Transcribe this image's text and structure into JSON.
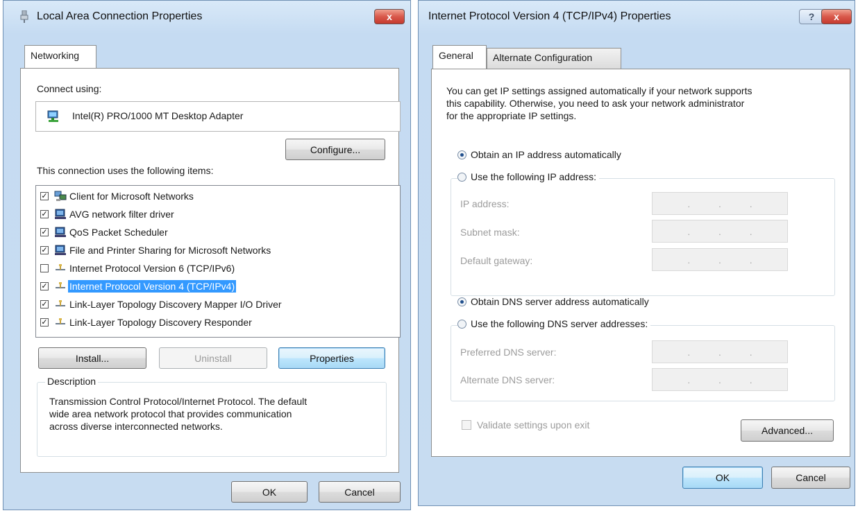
{
  "left_dialog": {
    "title": "Local Area Connection Properties",
    "close_label": "x",
    "tab": "Networking",
    "connect_using_label": "Connect using:",
    "adapter_name": "Intel(R) PRO/1000 MT Desktop Adapter",
    "configure_label": "Configure...",
    "items_label": "This connection uses the following items:",
    "items": [
      {
        "label": "Client for Microsoft Networks",
        "checked": true,
        "selected": false,
        "icon": "network-client-icon"
      },
      {
        "label": "AVG network filter driver",
        "checked": true,
        "selected": false,
        "icon": "network-service-icon"
      },
      {
        "label": "QoS Packet Scheduler",
        "checked": true,
        "selected": false,
        "icon": "network-service-icon"
      },
      {
        "label": "File and Printer Sharing for Microsoft Networks",
        "checked": true,
        "selected": false,
        "icon": "network-service-icon"
      },
      {
        "label": "Internet Protocol Version 6 (TCP/IPv6)",
        "checked": false,
        "selected": false,
        "icon": "protocol-icon"
      },
      {
        "label": "Internet Protocol Version 4 (TCP/IPv4)",
        "checked": true,
        "selected": true,
        "icon": "protocol-icon"
      },
      {
        "label": "Link-Layer Topology Discovery Mapper I/O Driver",
        "checked": true,
        "selected": false,
        "icon": "protocol-icon"
      },
      {
        "label": "Link-Layer Topology Discovery Responder",
        "checked": true,
        "selected": false,
        "icon": "protocol-icon"
      }
    ],
    "install_label": "Install...",
    "uninstall_label": "Uninstall",
    "properties_label": "Properties",
    "description_legend": "Description",
    "description_line1": "Transmission Control Protocol/Internet Protocol. The default",
    "description_line2": "wide area network protocol that provides communication",
    "description_line3": "across diverse interconnected networks.",
    "ok_label": "OK",
    "cancel_label": "Cancel"
  },
  "right_dialog": {
    "title": "Internet Protocol Version 4 (TCP/IPv4) Properties",
    "help_label": "?",
    "close_label": "x",
    "tab_general": "General",
    "tab_alternate": "Alternate Configuration",
    "intro_line1": "You can get IP settings assigned automatically if your network supports",
    "intro_line2": "this capability. Otherwise, you need to ask your network administrator",
    "intro_line3": "for the appropriate IP settings.",
    "obtain_ip_auto": "Obtain an IP address automatically",
    "use_following_ip": "Use the following IP address:",
    "ip_address_label": "IP address:",
    "subnet_mask_label": "Subnet mask:",
    "default_gateway_label": "Default gateway:",
    "obtain_dns_auto": "Obtain DNS server address automatically",
    "use_following_dns": "Use the following DNS server addresses:",
    "preferred_dns_label": "Preferred DNS server:",
    "alternate_dns_label": "Alternate DNS server:",
    "ip_dot": ".",
    "validate_label": "Validate settings upon exit",
    "advanced_label": "Advanced...",
    "ok_label": "OK",
    "cancel_label": "Cancel"
  },
  "colors": {
    "selection": "#3399ff",
    "close_button": "#d9584b",
    "titlebar": "#d9e9f8"
  }
}
